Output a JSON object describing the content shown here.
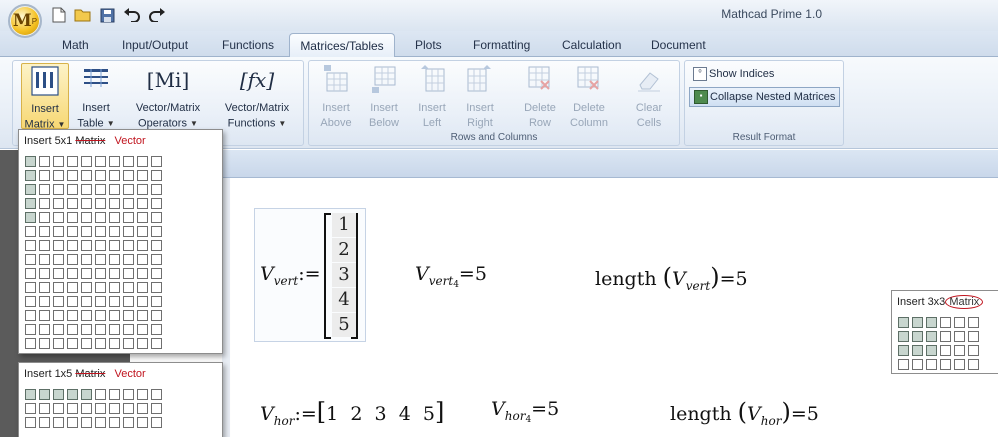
{
  "app": {
    "title": "Mathcad Prime 1.0",
    "logo_letter": "M",
    "logo_sup": "P"
  },
  "quick_access": [
    "new-icon",
    "open-icon",
    "save-icon",
    "undo-icon",
    "redo-icon"
  ],
  "tabs": [
    "Math",
    "Input/Output",
    "Functions",
    "Matrices/Tables",
    "Plots",
    "Formatting",
    "Calculation",
    "Document"
  ],
  "active_tab": "Matrices/Tables",
  "ribbon": {
    "insert_matrix": [
      "Insert",
      "Matrix"
    ],
    "insert_table": [
      "Insert",
      "Table"
    ],
    "vm_operators": [
      "Vector/Matrix",
      "Operators"
    ],
    "vm_functions": [
      "Vector/Matrix",
      "Functions"
    ],
    "vm_operators_glyph": "Mi",
    "vm_functions_glyph": "fx",
    "rows_cols": {
      "label": "Rows and Columns",
      "insert_above": [
        "Insert",
        "Above"
      ],
      "insert_below": [
        "Insert",
        "Below"
      ],
      "insert_left": [
        "Insert",
        "Left"
      ],
      "insert_right": [
        "Insert",
        "Right"
      ],
      "delete_row": [
        "Delete",
        "Row"
      ],
      "delete_column": [
        "Delete",
        "Column"
      ],
      "clear_cells": [
        "Clear",
        "Cells"
      ]
    },
    "result_format": {
      "label": "Result Format",
      "show_indices": "Show Indices",
      "collapse_nested": "Collapse Nested Matrices"
    }
  },
  "popups": {
    "p5x1": {
      "prefix": "Insert 5x1",
      "struck": "Matrix",
      "replacement": "Vector",
      "rows": 14,
      "cols": 10,
      "sel_rows": 5,
      "sel_cols": 1
    },
    "p1x5": {
      "prefix": "Insert 1x5",
      "struck": "Matrix",
      "replacement": "Vector",
      "rows": 3,
      "cols": 10,
      "sel_rows": 1,
      "sel_cols": 5
    },
    "p3x3": {
      "prefix": "Insert 3x3",
      "circled": "Matrix",
      "rows": 4,
      "cols": 6,
      "sel_rows": 3,
      "sel_cols": 3
    }
  },
  "math": {
    "vvert": {
      "var": "V",
      "sub": "vert",
      "assign": ":=",
      "values": [
        "1",
        "2",
        "3",
        "4",
        "5"
      ]
    },
    "vvert_index": {
      "var": "V",
      "sub": "vert",
      "index": "4",
      "eq": "=",
      "result": "5"
    },
    "vvert_length": {
      "fn": "length",
      "var": "V",
      "sub": "vert",
      "eq": "=",
      "result": "5"
    },
    "vhor": {
      "var": "V",
      "sub": "hor",
      "assign": ":=",
      "values": [
        "1",
        "2",
        "3",
        "4",
        "5"
      ]
    },
    "vhor_index": {
      "var": "V",
      "sub": "hor",
      "index": "4",
      "eq": "=",
      "result": "5"
    },
    "vhor_length": {
      "fn": "length",
      "var": "V",
      "sub": "hor",
      "eq": "=",
      "result": "5"
    }
  },
  "colors": {
    "accent_red": "#c0141e",
    "selected_cell": "#c8d6cf",
    "ribbon_bg": "#e6edf6"
  }
}
